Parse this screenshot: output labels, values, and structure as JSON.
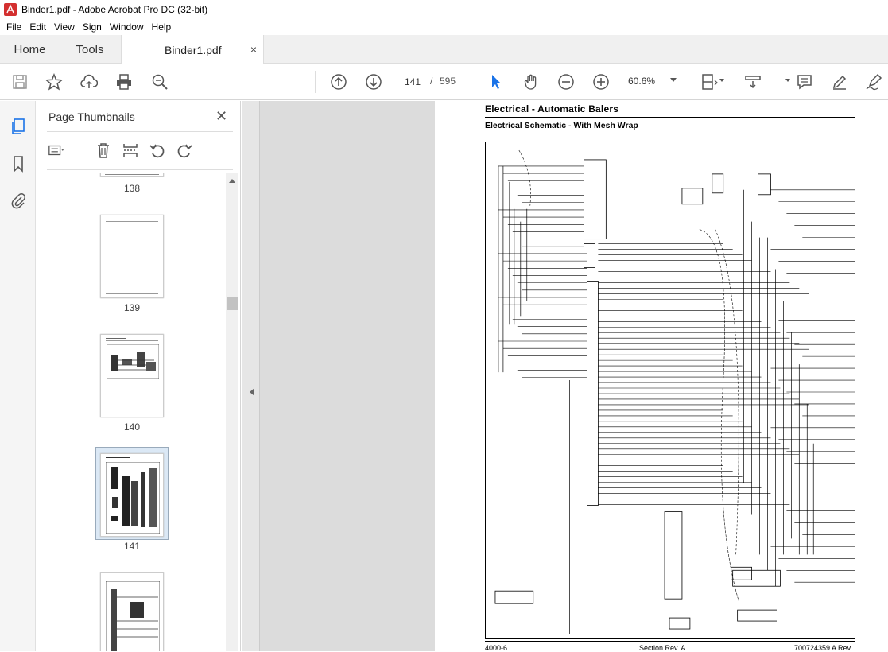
{
  "window": {
    "title": "Binder1.pdf - Adobe Acrobat Pro DC (32-bit)"
  },
  "menu": [
    "File",
    "Edit",
    "View",
    "Sign",
    "Window",
    "Help"
  ],
  "tabs": {
    "home": "Home",
    "tools": "Tools",
    "document": "Binder1.pdf",
    "close_glyph": "×"
  },
  "toolbar": {
    "current_page": "141",
    "separator": "/",
    "total_pages": "595",
    "zoom": "60.6%"
  },
  "panel": {
    "title": "Page Thumbnails",
    "close_glyph": "✕",
    "thumbnails": [
      {
        "label": "138"
      },
      {
        "label": "139"
      },
      {
        "label": "140"
      },
      {
        "label": "141",
        "selected": true
      },
      {
        "label": ""
      }
    ]
  },
  "document": {
    "title": "Electrical - Automatic Balers",
    "subtitle": "Electrical Schematic - With Mesh Wrap",
    "footer_left": "4000-6",
    "footer_center": "Section Rev. A",
    "footer_right": "700724359 A Rev."
  },
  "colors": {
    "accent_blue": "#1a73e8",
    "acrobat_red": "#d32f2f"
  }
}
